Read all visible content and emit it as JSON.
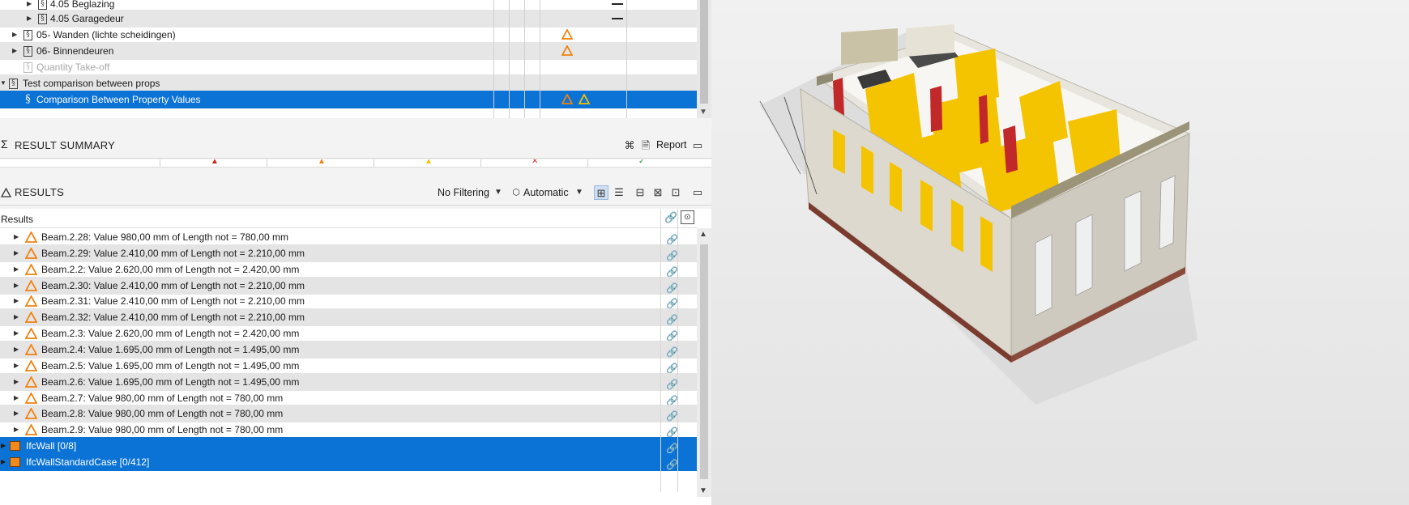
{
  "tree": {
    "rows": [
      {
        "label": "4.05 Beglazing"
      },
      {
        "label": "4.05 Garagedeur"
      },
      {
        "label": "05- Wanden (lichte scheidingen)"
      },
      {
        "label": "06- Binnendeuren"
      },
      {
        "label": "Quantity Take-off"
      },
      {
        "label": "Test comparison  between props"
      },
      {
        "label": "Comparison Between Property Values"
      }
    ]
  },
  "summary": {
    "title": "RESULT SUMMARY",
    "report_label": "Report"
  },
  "results_toolbar": {
    "title": "RESULTS",
    "filter_label": "No Filtering",
    "mode_label": "Automatic"
  },
  "results": {
    "column_title": "Results",
    "rows": [
      {
        "text": "Beam.2.28: Value 980,00 mm of Length not = 780,00 mm"
      },
      {
        "text": "Beam.2.29: Value 2.410,00 mm of Length not = 2.210,00 mm"
      },
      {
        "text": "Beam.2.2: Value 2.620,00 mm of Length not = 2.420,00 mm"
      },
      {
        "text": "Beam.2.30: Value 2.410,00 mm of Length not = 2.210,00 mm"
      },
      {
        "text": "Beam.2.31: Value 2.410,00 mm of Length not = 2.210,00 mm"
      },
      {
        "text": "Beam.2.32: Value 2.410,00 mm of Length not = 2.210,00 mm"
      },
      {
        "text": "Beam.2.3: Value 2.620,00 mm of Length not = 2.420,00 mm"
      },
      {
        "text": "Beam.2.4: Value 1.695,00 mm of Length not = 1.495,00 mm"
      },
      {
        "text": "Beam.2.5: Value 1.695,00 mm of Length not = 1.495,00 mm"
      },
      {
        "text": "Beam.2.6: Value 1.695,00 mm of Length not = 1.495,00 mm"
      },
      {
        "text": "Beam.2.7: Value 980,00 mm of Length not = 780,00 mm"
      },
      {
        "text": "Beam.2.8: Value 980,00 mm of Length not = 780,00 mm"
      },
      {
        "text": "Beam.2.9: Value 980,00 mm of Length not = 780,00 mm"
      }
    ],
    "groups": [
      {
        "text": "IfcWall [0/8]"
      },
      {
        "text": "IfcWallStandardCase [0/412]"
      }
    ]
  },
  "colors": {
    "selection": "#0b73d6",
    "warning": "#f0820f",
    "warning_yellow": "#e2a800",
    "element_yellow": "#f5c400",
    "element_red": "#c0282a"
  },
  "icons": [
    "paragraph-icon",
    "warning-icon",
    "sigma-icon",
    "link-icon",
    "report-icon",
    "filter-icon",
    "cube-icon",
    "layout-icon"
  ]
}
